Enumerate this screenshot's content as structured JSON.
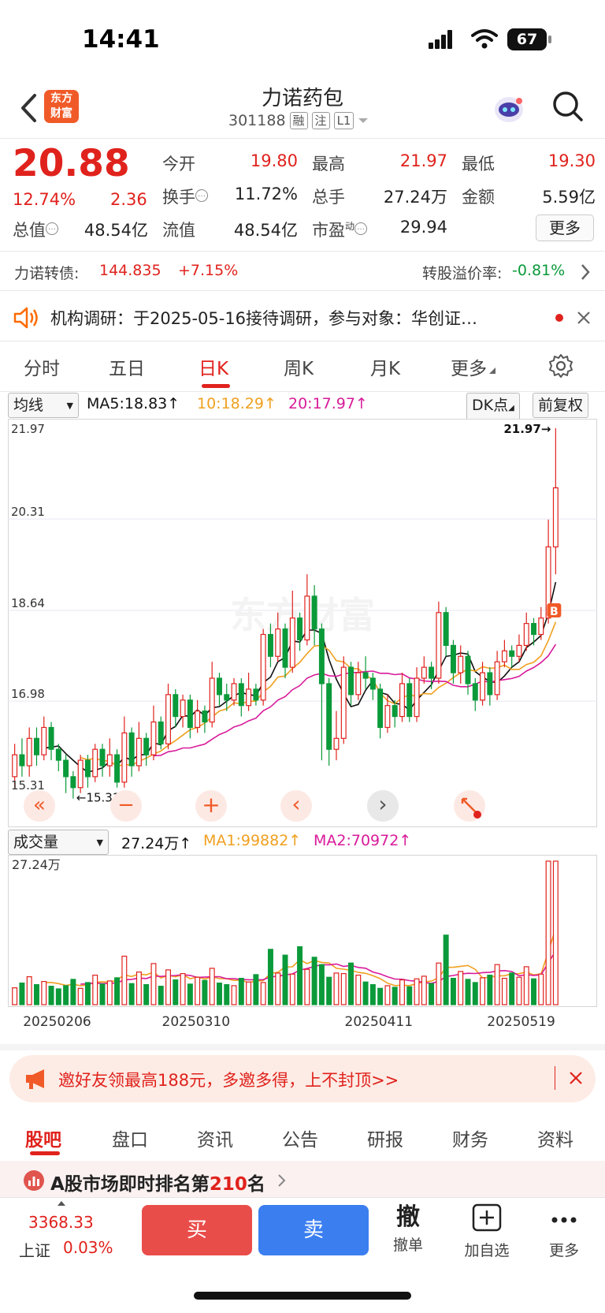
{
  "status_bar": {
    "time": "14:41",
    "battery": "67"
  },
  "header": {
    "logo_text": [
      "东方",
      "财富"
    ],
    "stock_name": "力诺药包",
    "stock_code": "301188",
    "tags": [
      "融",
      "注",
      "L1"
    ]
  },
  "quote": {
    "price": "20.88",
    "change_pct": "12.74%",
    "change_abs": "2.36",
    "rows": [
      [
        {
          "label": "今开",
          "value": "19.80",
          "color": "red"
        },
        {
          "label": "最高",
          "value": "21.97",
          "color": "red"
        },
        {
          "label": "最低",
          "value": "19.30",
          "color": "red"
        }
      ],
      [
        {
          "label": "换手",
          "value": "11.72%",
          "color": "dark"
        },
        {
          "label": "总手",
          "value": "27.24万",
          "color": "dark"
        },
        {
          "label": "金额",
          "value": "5.59亿",
          "color": "dark"
        }
      ],
      [
        {
          "label": "总值",
          "value": "48.54亿",
          "color": "dark"
        },
        {
          "label": "流值",
          "value": "48.54亿",
          "color": "dark"
        },
        {
          "label": "市盈",
          "sup": "动",
          "value": "29.94",
          "color": "dark"
        }
      ]
    ],
    "more_label": "更多"
  },
  "convertible": {
    "label": "力诺转债:",
    "price": "144.835",
    "change": "+7.15%",
    "premium_label": "转股溢价率:",
    "premium_value": "-0.81%"
  },
  "notice": {
    "text": "机构调研：于2025-05-16接待调研，参与对象：华创证…"
  },
  "chart_tabs": [
    "分时",
    "五日",
    "日K",
    "周K",
    "月K",
    "更多"
  ],
  "active_chart_tab": "日K",
  "kline_toolbar": {
    "indicator": "均线",
    "ma5": "MA5:18.83",
    "ma10": "10:18.29",
    "ma20": "20:17.97",
    "dk": "DK点",
    "adjust": "前复权"
  },
  "volume_toolbar": {
    "indicator": "成交量",
    "vol": "27.24万",
    "ma1": "MA1:99882",
    "ma2": "MA2:70972"
  },
  "colors": {
    "up": "#e0221d",
    "down": "#0a9a3a",
    "ma5": "#111111",
    "ma10": "#f0a020",
    "ma20": "#d81b9a"
  },
  "chart_data": {
    "type": "candlestick",
    "price_axis_labels": [
      "21.97",
      "20.31",
      "18.64",
      "16.98",
      "15.31"
    ],
    "ylim": [
      15.31,
      21.97
    ],
    "high_label": "21.97",
    "low_label": "15.31",
    "volume_axis_label": "27.24万",
    "date_labels": [
      "20250206",
      "20250310",
      "20250411",
      "20250519"
    ],
    "candles": [
      [
        15.6,
        16.0,
        16.2,
        15.4
      ],
      [
        16.0,
        15.8,
        16.3,
        15.6
      ],
      [
        15.8,
        16.3,
        16.5,
        15.6
      ],
      [
        16.3,
        16.0,
        16.5,
        15.8
      ],
      [
        16.0,
        16.5,
        16.7,
        15.9
      ],
      [
        16.5,
        16.1,
        16.6,
        15.9
      ],
      [
        16.1,
        15.9,
        16.2,
        15.7
      ],
      [
        15.9,
        15.6,
        16.0,
        15.3
      ],
      [
        15.6,
        15.4,
        15.7,
        15.2
      ],
      [
        15.4,
        15.9,
        16.0,
        15.3
      ],
      [
        15.9,
        15.6,
        16.0,
        15.4
      ],
      [
        15.6,
        16.1,
        16.2,
        15.5
      ],
      [
        16.1,
        15.8,
        16.2,
        15.6
      ],
      [
        15.8,
        16.0,
        16.3,
        15.6
      ],
      [
        16.0,
        15.5,
        16.1,
        15.4
      ],
      [
        15.5,
        16.4,
        16.7,
        15.4
      ],
      [
        16.4,
        15.8,
        16.5,
        15.6
      ],
      [
        15.8,
        16.3,
        16.6,
        15.7
      ],
      [
        16.3,
        16.0,
        16.4,
        15.8
      ],
      [
        16.0,
        16.6,
        16.9,
        15.9
      ],
      [
        16.6,
        16.2,
        16.7,
        16.1
      ],
      [
        16.2,
        17.1,
        17.3,
        16.1
      ],
      [
        17.1,
        16.7,
        17.2,
        16.5
      ],
      [
        16.7,
        17.0,
        17.1,
        16.5
      ],
      [
        17.0,
        16.5,
        17.1,
        16.3
      ],
      [
        16.5,
        16.8,
        17.0,
        16.4
      ],
      [
        16.8,
        16.6,
        16.9,
        16.4
      ],
      [
        16.6,
        17.4,
        17.7,
        16.5
      ],
      [
        17.4,
        17.1,
        17.5,
        16.9
      ],
      [
        17.1,
        17.0,
        17.3,
        16.8
      ],
      [
        17.0,
        17.3,
        17.4,
        16.9
      ],
      [
        17.3,
        16.9,
        17.4,
        16.7
      ],
      [
        16.9,
        17.2,
        17.5,
        16.8
      ],
      [
        17.2,
        17.0,
        17.3,
        16.9
      ],
      [
        17.0,
        18.2,
        18.3,
        16.9
      ],
      [
        18.2,
        17.8,
        18.4,
        17.6
      ],
      [
        17.8,
        18.3,
        18.6,
        17.7
      ],
      [
        18.3,
        17.6,
        18.4,
        17.4
      ],
      [
        17.6,
        18.5,
        19.0,
        17.5
      ],
      [
        18.5,
        18.1,
        18.6,
        17.9
      ],
      [
        18.1,
        18.9,
        19.3,
        18.0
      ],
      [
        18.9,
        18.3,
        19.1,
        18.0
      ],
      [
        18.3,
        17.3,
        18.4,
        15.9
      ],
      [
        17.3,
        16.1,
        17.4,
        15.8
      ],
      [
        16.1,
        16.3,
        16.8,
        15.9
      ],
      [
        16.3,
        17.6,
        17.8,
        16.2
      ],
      [
        17.6,
        17.1,
        17.7,
        16.9
      ],
      [
        17.1,
        17.5,
        17.7,
        17.0
      ],
      [
        17.5,
        17.4,
        17.8,
        17.2
      ],
      [
        17.4,
        17.2,
        17.5,
        17.0
      ],
      [
        17.2,
        16.5,
        17.3,
        16.3
      ],
      [
        16.5,
        16.9,
        17.1,
        16.4
      ],
      [
        16.9,
        16.7,
        17.0,
        16.5
      ],
      [
        16.7,
        17.3,
        17.5,
        16.6
      ],
      [
        17.3,
        16.7,
        17.4,
        16.6
      ],
      [
        16.7,
        17.4,
        17.6,
        16.6
      ],
      [
        17.4,
        17.6,
        17.8,
        17.3
      ],
      [
        17.6,
        17.4,
        17.7,
        17.2
      ],
      [
        17.4,
        18.6,
        18.8,
        17.3
      ],
      [
        18.6,
        18.0,
        18.7,
        17.8
      ],
      [
        18.0,
        17.5,
        18.1,
        17.3
      ],
      [
        17.5,
        17.8,
        18.0,
        17.3
      ],
      [
        17.8,
        17.3,
        17.9,
        17.1
      ],
      [
        17.3,
        17.0,
        17.4,
        16.8
      ],
      [
        17.0,
        17.5,
        17.7,
        16.9
      ],
      [
        17.5,
        17.1,
        17.6,
        16.9
      ],
      [
        17.1,
        17.7,
        17.9,
        17.0
      ],
      [
        17.7,
        17.9,
        18.1,
        17.6
      ],
      [
        17.9,
        17.8,
        18.0,
        17.6
      ],
      [
        17.8,
        18.0,
        18.2,
        17.7
      ],
      [
        18.0,
        18.4,
        18.6,
        17.9
      ],
      [
        18.4,
        18.2,
        18.5,
        18.0
      ],
      [
        18.2,
        18.5,
        18.7,
        18.1
      ],
      [
        18.5,
        19.8,
        20.3,
        18.4
      ],
      [
        19.8,
        20.88,
        21.97,
        19.3
      ]
    ],
    "volumes": [
      3.2,
      4.1,
      5.3,
      3.8,
      4.4,
      3.5,
      3.0,
      3.6,
      4.8,
      3.1,
      4.2,
      5.6,
      3.9,
      4.5,
      5.1,
      9.2,
      4.0,
      6.2,
      3.8,
      7.8,
      3.5,
      6.6,
      4.7,
      5.9,
      3.9,
      5.2,
      4.6,
      6.9,
      4.1,
      3.8,
      3.6,
      5.0,
      4.3,
      5.7,
      4.2,
      10.5,
      6.0,
      9.4,
      5.8,
      11.0,
      6.7,
      9.0,
      7.6,
      5.2,
      6.0,
      5.9,
      7.9,
      5.6,
      4.3,
      3.8,
      3.1,
      3.6,
      3.3,
      4.7,
      3.4,
      4.9,
      5.4,
      4.0,
      7.9,
      13.2,
      5.0,
      6.3,
      4.8,
      4.2,
      5.1,
      5.6,
      7.6,
      5.0,
      6.0,
      5.2,
      7.2,
      4.9,
      5.8,
      27.24,
      27.24
    ]
  },
  "chart_controls": {
    "prev": "«",
    "zoom_out": "−",
    "zoom_in": "+",
    "left": "‹",
    "right": "›"
  },
  "watermark": "东方财富",
  "b_marker": "B",
  "promo_banner": {
    "text": "邀好友领最高188元，多邀多得，上不封顶>>"
  },
  "bottom_tabs": [
    "股吧",
    "盘口",
    "资讯",
    "公告",
    "研报",
    "财务",
    "资料"
  ],
  "active_bottom_tab": "股吧",
  "ranking": {
    "prefix": "A股市场即时排名第",
    "rank": "210",
    "suffix": "名"
  },
  "footer": {
    "index_value": "3368.33",
    "index_name": "上证",
    "index_change": "0.03%",
    "buy_label": "买",
    "sell_label": "卖",
    "cancel_glyph": "撤",
    "cancel_label": "撤单",
    "watch_label": "加自选",
    "more_label": "更多"
  }
}
